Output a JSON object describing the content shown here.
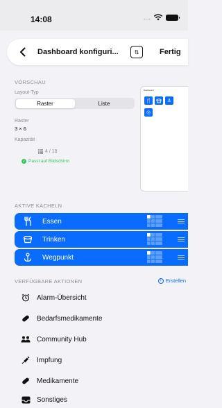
{
  "status_bar": {
    "time": "14:08",
    "signal": "...."
  },
  "nav": {
    "title": "Dashboard konfiguri...",
    "done_label": "Fertig"
  },
  "preview": {
    "section_title": "VORSCHAU",
    "layout_type_label": "Layout-Typ",
    "segments": [
      "Raster",
      "Liste"
    ],
    "selected_segment": "Raster",
    "grid_label": "Raster",
    "grid_value": "3 × 6",
    "capacity_label": "Kapazität",
    "capacity_value": "4 / 18",
    "fits_text": "Passt auf Bildschirm",
    "phone_title": "Dashboard"
  },
  "active_tiles": {
    "section_title": "AKTIVE KACHELN",
    "items": [
      {
        "label": "Essen",
        "icon": "fork-knife-icon"
      },
      {
        "label": "Trinken",
        "icon": "cup-icon"
      },
      {
        "label": "Wegpunkt",
        "icon": "waypoint-icon"
      }
    ]
  },
  "available_actions": {
    "section_title": "VERFÜGBARE AKTIONEN",
    "create_label": "Erstellen",
    "items": [
      {
        "label": "Alarm-Übersicht",
        "icon": "alarm-clock-icon"
      },
      {
        "label": "Bedarfsmedikamente",
        "icon": "pill-icon"
      },
      {
        "label": "Community Hub",
        "icon": "people-icon"
      },
      {
        "label": "Impfung",
        "icon": "syringe-icon"
      },
      {
        "label": "Medikamente",
        "icon": "pill-icon"
      },
      {
        "label": "Sonstiges",
        "icon": "tray-icon"
      }
    ]
  },
  "colors": {
    "accent": "#0a6cff",
    "success": "#34c759",
    "background": "#f2f2f7"
  }
}
